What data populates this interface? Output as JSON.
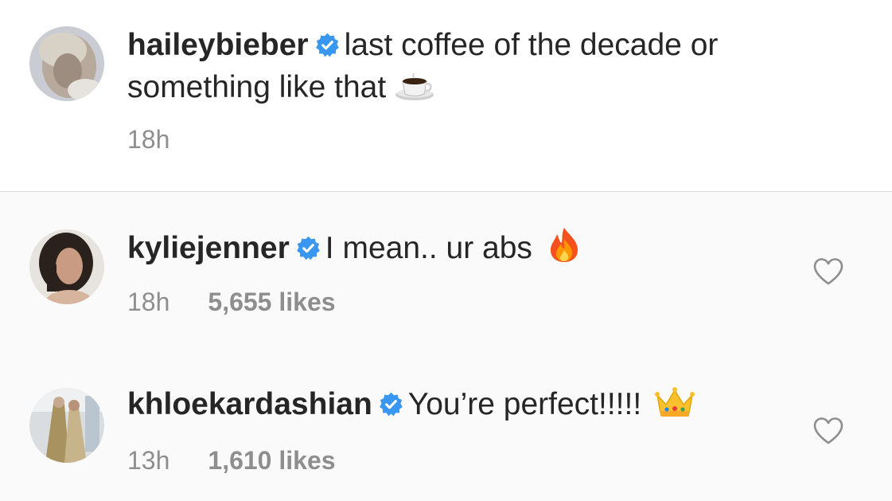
{
  "caption": {
    "username": "haileybieber",
    "text_line1": "last coffee of the decade or",
    "text_line2": "something like that",
    "emoji": "coffee-emoji",
    "time": "18h"
  },
  "comments": [
    {
      "username": "kyliejenner",
      "text": "I mean.. ur abs",
      "emoji": "fire-emoji",
      "time": "18h",
      "likes": "5,655 likes"
    },
    {
      "username": "khloekardashian",
      "text": "You’re perfect!!!!!",
      "emoji": "crown-emoji",
      "time": "13h",
      "likes": "1,610 likes"
    }
  ],
  "colors": {
    "verified": "#3897f0",
    "meta_text": "#8e8e8e",
    "comment_bg": "#fafafa",
    "divider": "#dbdbdb"
  }
}
